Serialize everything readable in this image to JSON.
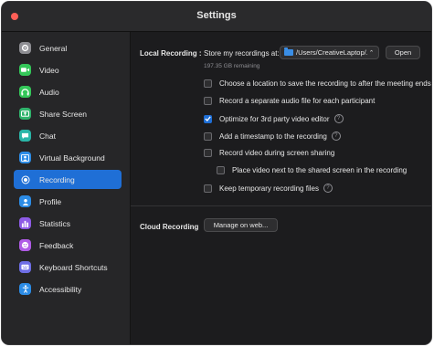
{
  "window": {
    "title": "Settings"
  },
  "sidebar": {
    "items": [
      {
        "label": "General",
        "icon": "gear-icon",
        "color": "#8e8e93"
      },
      {
        "label": "Video",
        "icon": "video-icon",
        "color": "#34c759"
      },
      {
        "label": "Audio",
        "icon": "headphones-icon",
        "color": "#34c759"
      },
      {
        "label": "Share Screen",
        "icon": "share-screen-icon",
        "color": "#30b46c"
      },
      {
        "label": "Chat",
        "icon": "chat-icon",
        "color": "#2ab6a8"
      },
      {
        "label": "Virtual Background",
        "icon": "person-background-icon",
        "color": "#2c8ce6"
      },
      {
        "label": "Recording",
        "icon": "record-icon",
        "color": "#1f6fd6",
        "active": true
      },
      {
        "label": "Profile",
        "icon": "profile-icon",
        "color": "#2c8ce6"
      },
      {
        "label": "Statistics",
        "icon": "statistics-icon",
        "color": "#8e5be6"
      },
      {
        "label": "Feedback",
        "icon": "feedback-icon",
        "color": "#b05be6"
      },
      {
        "label": "Keyboard Shortcuts",
        "icon": "keyboard-icon",
        "color": "#6e6ee6"
      },
      {
        "label": "Accessibility",
        "icon": "accessibility-icon",
        "color": "#2c8ce6"
      }
    ]
  },
  "local": {
    "label": "Local Recording :",
    "store_label": "Store my recordings at:",
    "path": "/Users/CreativeLaptop/...",
    "open_label": "Open",
    "remaining": "197.35 GB remaining",
    "options": [
      {
        "label": "Choose a location to save the recording to after the meeting ends",
        "checked": false,
        "help": false
      },
      {
        "label": "Record a separate audio file for each participant",
        "checked": false,
        "help": false
      },
      {
        "label": "Optimize for 3rd party video editor",
        "checked": true,
        "help": true
      },
      {
        "label": "Add a timestamp to the recording",
        "checked": false,
        "help": true
      },
      {
        "label": "Record video during screen sharing",
        "checked": false,
        "help": false
      },
      {
        "label": "Place video next to the shared screen in the recording",
        "checked": false,
        "help": false
      },
      {
        "label": "Keep temporary recording files",
        "checked": false,
        "help": true
      }
    ]
  },
  "cloud": {
    "label": "Cloud Recording",
    "manage_label": "Manage on web..."
  }
}
